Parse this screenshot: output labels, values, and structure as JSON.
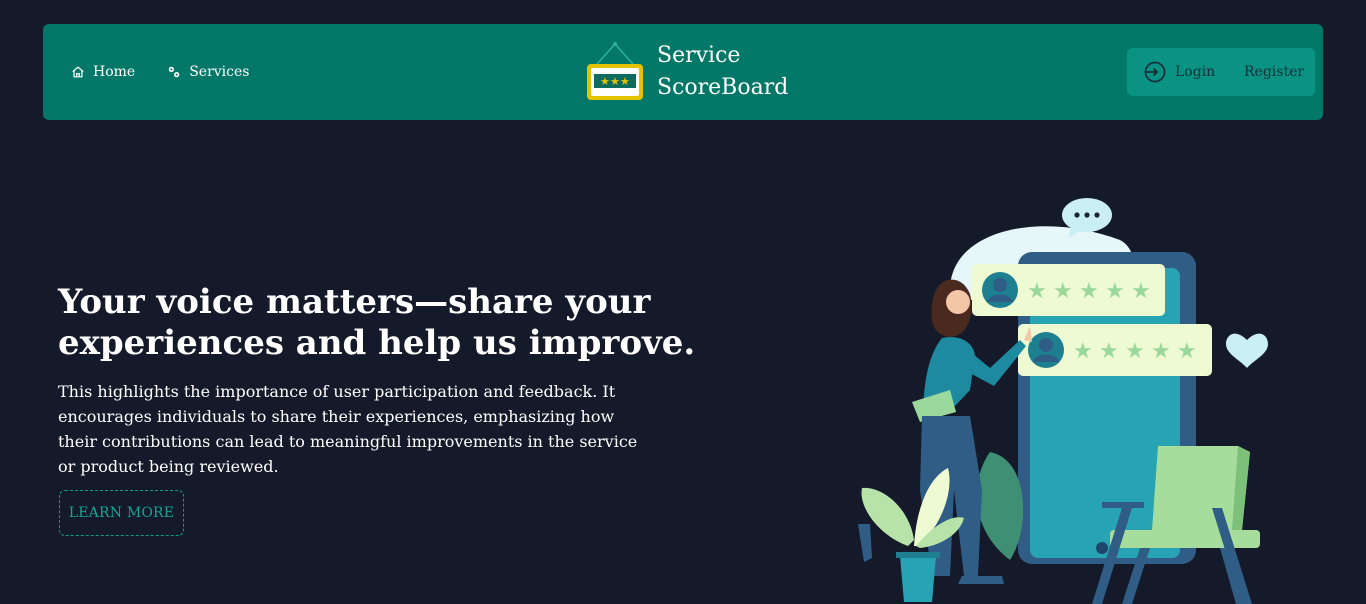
{
  "nav": {
    "links": [
      {
        "label": "Home",
        "icon": "home-icon"
      },
      {
        "label": "Services",
        "icon": "gears-icon"
      }
    ],
    "brand": {
      "line1": "Service",
      "line2": "ScoreBoard",
      "logo": "scoreboard-logo"
    },
    "auth": {
      "login_label": "Login",
      "login_icon": "login-icon",
      "register_label": "Register"
    }
  },
  "hero": {
    "title": "Your voice matters—share your experiences and help us improve.",
    "description": "This highlights the importance of user participation and feedback. It encourages individuals to share their experiences, emphasizing how their contributions can lead to meaningful improvements in the service or product being reviewed.",
    "cta_label": "LEARN MORE"
  },
  "illustration": {
    "review_cards": [
      {
        "stars": 5
      },
      {
        "stars": 5
      }
    ]
  },
  "colors": {
    "background": "#141a29",
    "navbar": "#037868",
    "auth_box": "#0a9282",
    "accent": "#17a593"
  }
}
